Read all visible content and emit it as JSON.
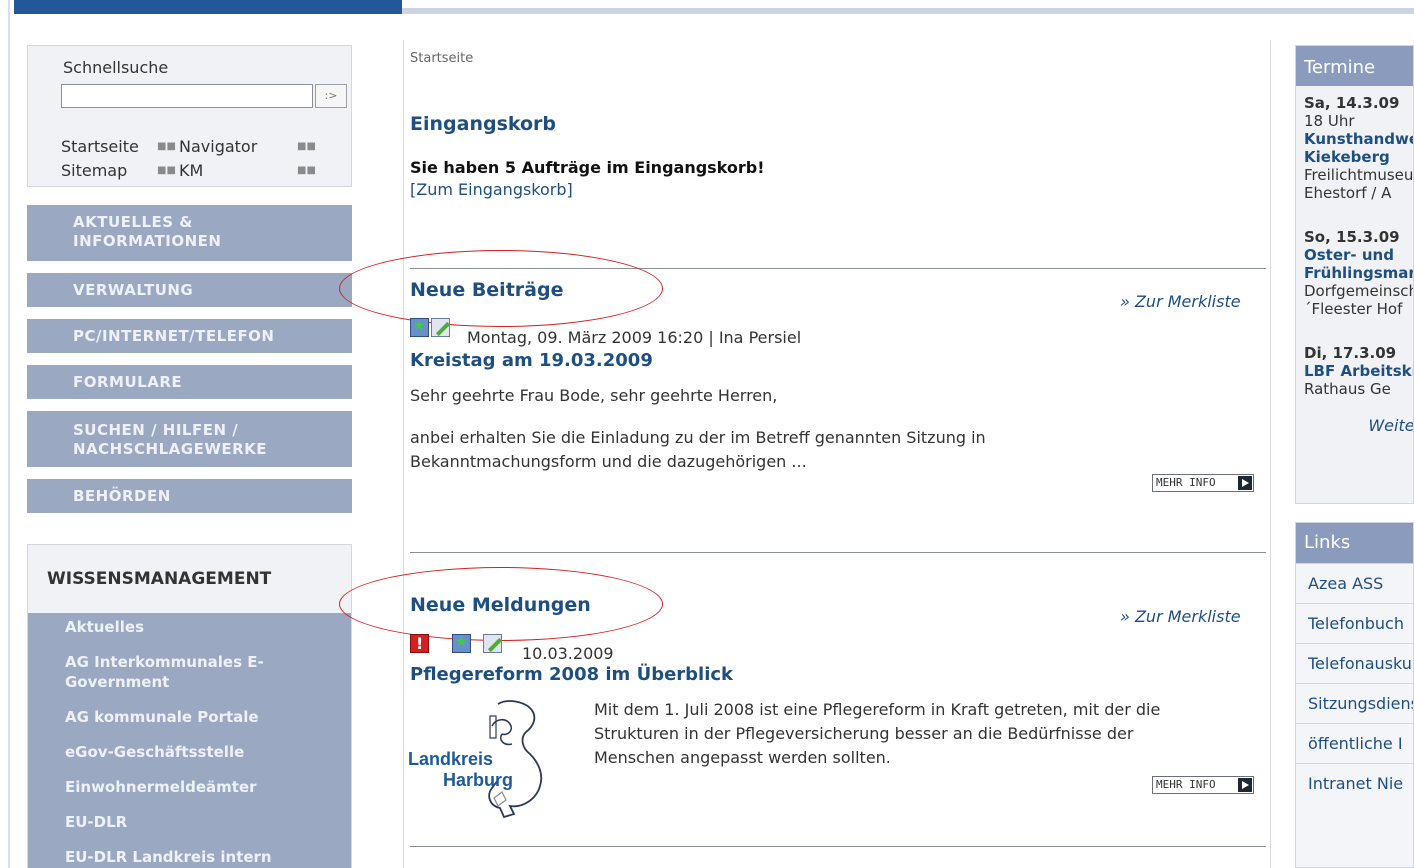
{
  "quicksearch": {
    "title": "Schnellsuche",
    "input_value": "",
    "go_label": ":>",
    "links": [
      "Startseite",
      "Navigator",
      "Sitemap",
      "KM"
    ]
  },
  "nav": {
    "items": [
      [
        "AKTUELLES &",
        "INFORMATIONEN"
      ],
      [
        "VERWALTUNG"
      ],
      [
        "PC/INTERNET/TELEFON"
      ],
      [
        "FORMULARE"
      ],
      [
        "SUCHEN / HILFEN /",
        "NACHSCHLAGEWERKE"
      ],
      [
        "BEHÖRDEN"
      ]
    ]
  },
  "wissensmanagement": {
    "title": "WISSENSMANAGEMENT",
    "items": [
      [
        "Aktuelles"
      ],
      [
        "AG Interkommunales E-",
        "Government"
      ],
      [
        "AG kommunale Portale"
      ],
      [
        "eGov-Geschäftsstelle"
      ],
      [
        "Einwohnermeldeämter"
      ],
      [
        "EU-DLR"
      ],
      [
        "EU-DLR Landkreis intern"
      ]
    ]
  },
  "main": {
    "breadcrumb": "Startseite",
    "inbox": {
      "title": "Eingangskorb",
      "message": "Sie haben 5 Aufträge im Eingangskorb!",
      "link": "[Zum Eingangskorb]"
    },
    "posts": {
      "title": "Neue Beiträge",
      "merkliste": "» Zur Merkliste",
      "meta": "Montag, 09. März 2009 16:20 | Ina Persiel",
      "item_title": "Kreistag am 19.03.2009",
      "line1": "Sehr geehrte Frau Bode, sehr geehrte Herren,",
      "line2": "anbei erhalten Sie die Einladung zu der im Betreff genannten Sitzung in",
      "line3": "Bekanntmachungsform und die dazugehörigen ...",
      "more": "MEHR INFO"
    },
    "news": {
      "title": "Neue Meldungen",
      "merkliste": "» Zur Merkliste",
      "date": "10.03.2009",
      "item_title": "Pflegereform 2008 im Überblick",
      "line1": "Mit dem 1. Juli 2008 ist eine Pflegereform in Kraft getreten, mit der die",
      "line2": "Strukturen in der Pflegeversicherung besser an die Bedürfnisse der",
      "line3": "Menschen angepasst werden sollten.",
      "more": "MEHR INFO",
      "logo_line1": "Landkreis",
      "logo_line2": "Harburg"
    }
  },
  "termine": {
    "title": "Termine",
    "entries": [
      {
        "date": "Sa, 14.3.09",
        "time": "18 Uhr",
        "title": [
          "Kunsthandwerk",
          "Kiekeberg"
        ],
        "place": [
          "Freilichtmuseum",
          "Ehestorf / A"
        ]
      },
      {
        "date": "So, 15.3.09",
        "time": "",
        "title": [
          "Oster- und",
          "Frühlingsmarkt"
        ],
        "place": [
          "Dorfgemeinschaft",
          "´Fleester Hof"
        ]
      },
      {
        "date": "Di, 17.3.09",
        "time": "",
        "title": [
          "LBF Arbeitskreis"
        ],
        "place": [
          "Rathaus Ge"
        ]
      }
    ],
    "more": "Weitere"
  },
  "links": {
    "title": "Links",
    "items": [
      "Azea ASS",
      "Telefonbuch",
      "Telefonauskunft",
      "Sitzungsdienst",
      "öffentliche I",
      "Intranet Nie"
    ]
  }
}
